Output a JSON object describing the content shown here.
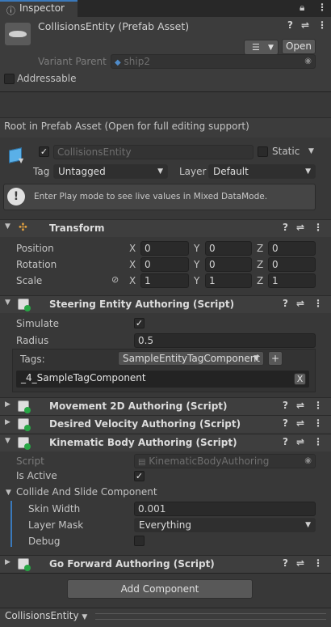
{
  "tab": {
    "title": "Inspector"
  },
  "asset": {
    "name": "CollisionsEntity (Prefab Asset)",
    "open_label": "Open",
    "variant_parent_label": "Variant Parent",
    "variant_parent_value": "ship2",
    "addressable_label": "Addressable"
  },
  "root_notice": "Root in Prefab Asset (Open for full editing support)",
  "gameobject": {
    "name": "CollisionsEntity",
    "static_label": "Static",
    "tag_label": "Tag",
    "tag_value": "Untagged",
    "layer_label": "Layer",
    "layer_value": "Default",
    "info": "Enter Play mode to see live values in Mixed DataMode."
  },
  "transform": {
    "title": "Transform",
    "position_label": "Position",
    "rotation_label": "Rotation",
    "scale_label": "Scale",
    "x_label": "X",
    "y_label": "Y",
    "z_label": "Z",
    "position": [
      "0",
      "0",
      "0"
    ],
    "rotation": [
      "0",
      "0",
      "0"
    ],
    "scale": [
      "1",
      "1",
      "1"
    ]
  },
  "steering": {
    "title": "Steering Entity Authoring (Script)",
    "simulate_label": "Simulate",
    "simulate_checked": true,
    "radius_label": "Radius",
    "radius_value": "0.5",
    "tags_label": "Tags:",
    "tags_dropdown": "SampleEntityTagComponent",
    "add_symbol": "+",
    "tag_item": "_4_SampleTagComponent",
    "remove_symbol": "X"
  },
  "movement": {
    "title": "Movement 2D Authoring (Script)"
  },
  "desired": {
    "title": "Desired Velocity Authoring (Script)"
  },
  "kinematic": {
    "title": "Kinematic Body Authoring (Script)",
    "script_label": "Script",
    "script_value": "KinematicBodyAuthoring",
    "is_active_label": "Is Active",
    "is_active_checked": true,
    "collide_label": "Collide And Slide Component",
    "skin_width_label": "Skin Width",
    "skin_width_value": "0.001",
    "layer_mask_label": "Layer Mask",
    "layer_mask_value": "Everything",
    "debug_label": "Debug",
    "debug_checked": false
  },
  "goforward": {
    "title": "Go Forward Authoring (Script)"
  },
  "add_component_label": "Add Component",
  "footer": {
    "entity_dropdown": "CollisionsEntity"
  },
  "icons": [
    "inspector-icon",
    "lock-icon",
    "more-vert-icon",
    "prefab-icon",
    "list-icon",
    "target-icon",
    "cube-icon",
    "info-icon",
    "transform-axes-icon",
    "help-icon",
    "sliders-icon",
    "script-icon",
    "link-off-icon"
  ]
}
